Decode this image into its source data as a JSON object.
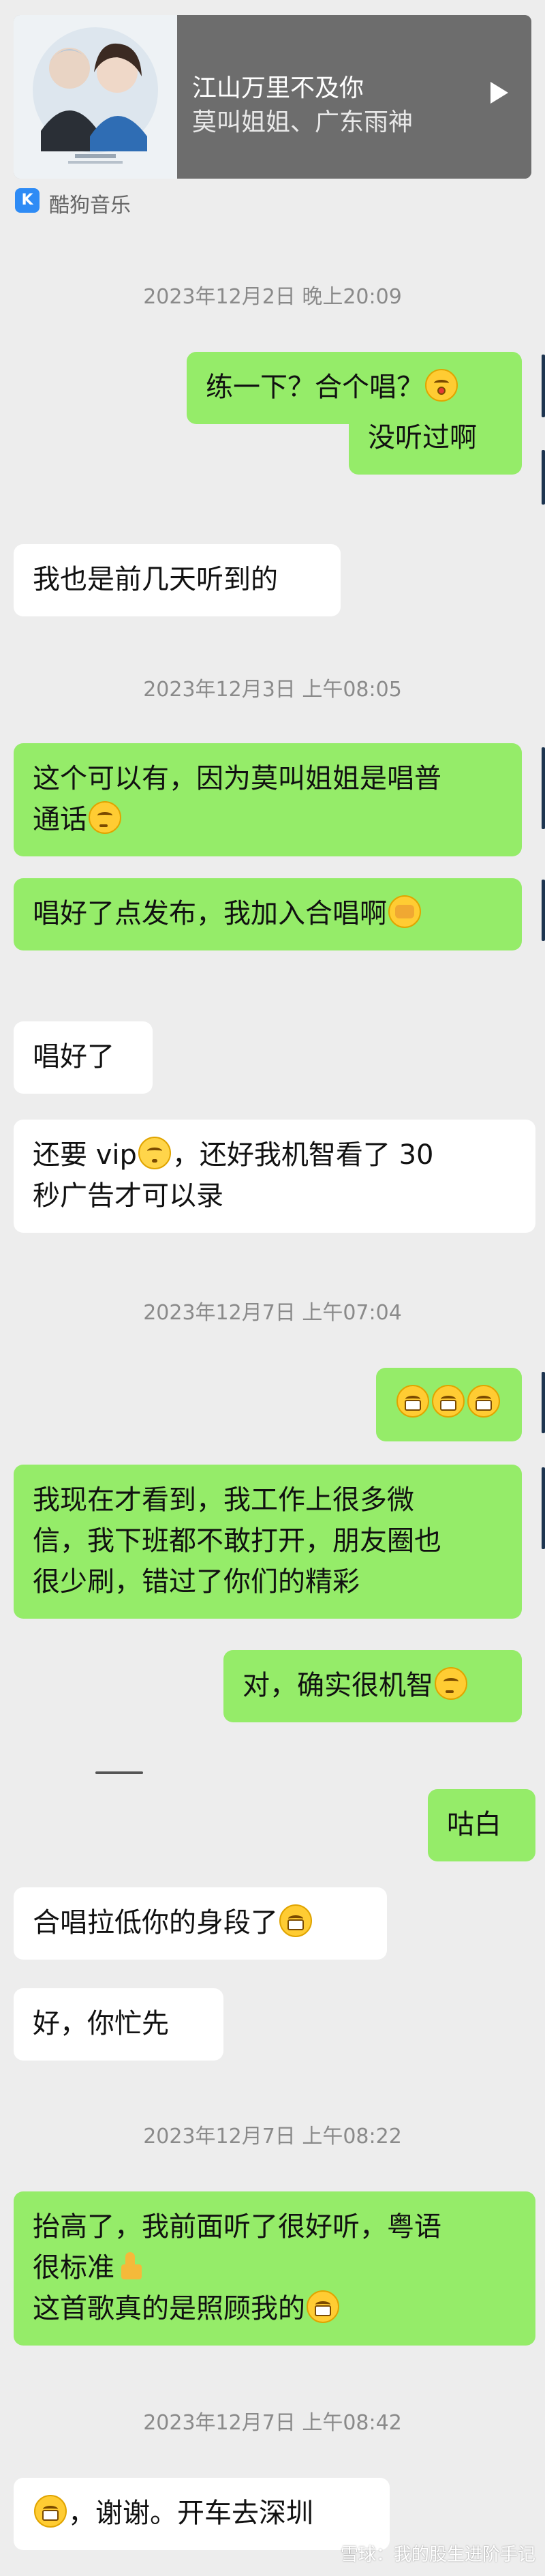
{
  "music_card": {
    "title": "江山万里不及你",
    "artists": "莫叫姐姐、广东雨神",
    "source": "酷狗音乐",
    "source_icon_letter": "K"
  },
  "timestamps": {
    "t1": "2023年12月2日 晚上20:09",
    "t2": "2023年12月3日 上午08:05",
    "t3": "2023年12月7日 上午07:04",
    "t4": "2023年12月7日 上午08:22",
    "t5": "2023年12月7日 上午08:42"
  },
  "messages": {
    "m1": "练一下？合个唱？",
    "m2": "没听过啊",
    "m3": "我也是前几天听到的",
    "m4_line1": "这个可以有，因为莫叫姐姐是唱普",
    "m4_line2": "通话",
    "m5": "唱好了点发布，我加入合唱啊",
    "m6": "唱好了",
    "m7_line1a": "还要 vip",
    "m7_line1b": "，还好我机智看了 30",
    "m7_line2": "秒广告才可以录",
    "m9_line1": "我现在才看到，我工作上很多微",
    "m9_line2": "信，我下班都不敢打开，朋友圈也",
    "m9_line3": "很少刷，错过了你们的精彩",
    "m10": "对，确实很机智",
    "m11": "咕白",
    "m12": "合唱拉低你的身段了",
    "m13": "好，你忙先",
    "m14_line1": "抬高了，我前面听了很好听，粤语",
    "m14_line2": "很标准",
    "m14_line3": "这首歌真的是照顾我的",
    "m15": "，谢谢。开车去深圳"
  },
  "watermark": "雪球：我的股生进阶手记"
}
